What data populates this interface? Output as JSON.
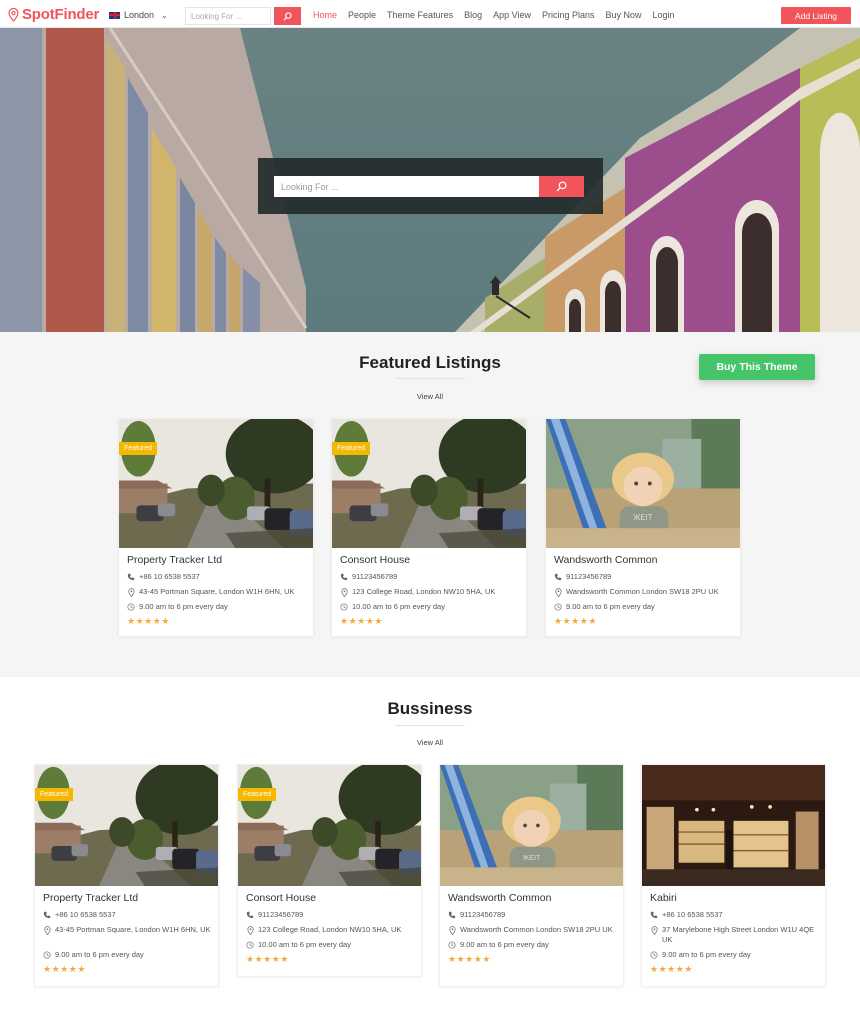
{
  "header": {
    "brand": "SpotFinder",
    "city": "London",
    "search_placeholder": "Looking For ...",
    "nav": [
      {
        "label": "Home",
        "active": true
      },
      {
        "label": "People",
        "active": false
      },
      {
        "label": "Theme Features",
        "active": false
      },
      {
        "label": "Blog",
        "active": false
      },
      {
        "label": "App View",
        "active": false
      },
      {
        "label": "Pricing Plans",
        "active": false
      },
      {
        "label": "Buy Now",
        "active": false
      },
      {
        "label": "Login",
        "active": false
      }
    ],
    "add_listing_label": "Add Listing"
  },
  "hero": {
    "search_placeholder": "Looking For ..."
  },
  "featured": {
    "title": "Featured Listings",
    "view_all": "View All",
    "buy_theme_label": "Buy This Theme",
    "listings": [
      {
        "name": "Property Tracker Ltd",
        "phone": "+86 10 6538 5537",
        "address": "43-45 Portman Square, London W1H 6HN, UK",
        "hours": "9.00 am to 6 pm every day",
        "rating": 5,
        "badge": "Featured",
        "image": "street"
      },
      {
        "name": "Consort House",
        "phone": "91123456789",
        "address": "123 College Road, London NW10 5HA, UK",
        "hours": "10.00 am to 6 pm every day",
        "rating": 5,
        "badge": "Featured",
        "image": "street"
      },
      {
        "name": "Wandsworth Common",
        "phone": "91123456789",
        "address": "Wandsworth Common London SW18 2PU UK",
        "hours": "9.00 am to 6 pm every day",
        "rating": 5,
        "badge": "",
        "image": "child"
      }
    ]
  },
  "business": {
    "title": "Bussiness",
    "view_all": "View All",
    "listings": [
      {
        "name": "Property Tracker Ltd",
        "phone": "+86 10 6538 5537",
        "address": "43-45 Portman Square, London W1H 6HN, UK",
        "hours": "9.00 am to 6 pm every day",
        "rating": 5,
        "badge": "Featured",
        "image": "street"
      },
      {
        "name": "Consort House",
        "phone": "91123456789",
        "address": "123 College Road, London NW10 5HA, UK",
        "hours": "10.00 am to 6 pm every day",
        "rating": 5,
        "badge": "Featured",
        "image": "street"
      },
      {
        "name": "Wandsworth Common",
        "phone": "91123456789",
        "address": "Wandsworth Common London SW18 2PU UK",
        "hours": "9.00 am to 6 pm every day",
        "rating": 5,
        "badge": "",
        "image": "child"
      },
      {
        "name": "Kabiri",
        "phone": "+86 10 6538 5537",
        "address": "37 Marylebone High Street London W1U 4QE UK",
        "hours": "9.00 am to 6 pm every day",
        "rating": 5,
        "badge": "",
        "image": "shop"
      }
    ]
  },
  "colors": {
    "accent": "#f2545b",
    "buy_theme": "#46c46a",
    "badge": "#f5b700",
    "stars": "#f3a93b"
  }
}
